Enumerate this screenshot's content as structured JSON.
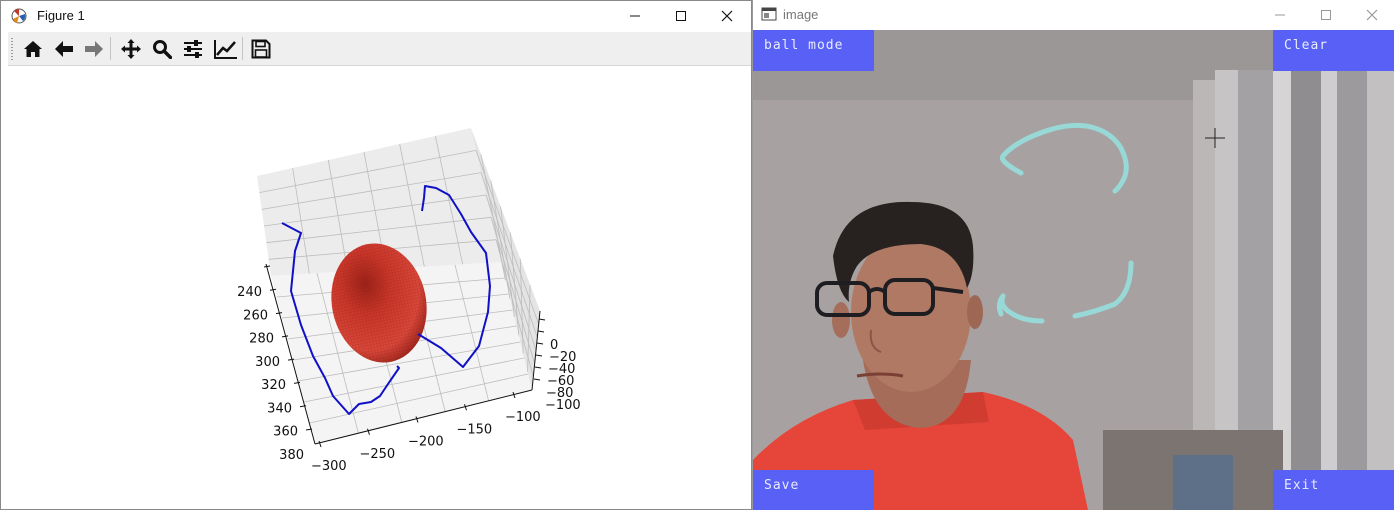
{
  "figure_window": {
    "title": "Figure 1",
    "toolbar": [
      "home-icon",
      "back-icon",
      "forward-icon",
      "pan-icon",
      "zoom-icon",
      "configure-subplots-icon",
      "edit-axes-icon",
      "save-icon"
    ]
  },
  "chart_data": {
    "type": "3d-scatter-line",
    "x_ticks": [
      "−300",
      "−250",
      "−200",
      "−150",
      "−100"
    ],
    "y_ticks": [
      "240",
      "260",
      "280",
      "300",
      "320",
      "340",
      "360",
      "380"
    ],
    "z_ticks": [
      "0",
      "−20",
      "−40",
      "−60",
      "−80",
      "−100"
    ],
    "series": [
      {
        "type": "line",
        "color": "#1010c8"
      },
      {
        "type": "ellipsoid-surface",
        "color": "#c0392b"
      }
    ],
    "grid": true,
    "colors": {
      "line": "#1010c8",
      "ellipsoid_light": "#d64a3a",
      "ellipsoid_dark": "#8a1a12",
      "pane": "#eaeaea",
      "grid": "#bcbcbc"
    }
  },
  "image_window": {
    "title": "image",
    "buttons": {
      "ball_mode": "ball mode",
      "clear": "Clear",
      "save": "Save",
      "exit": "Exit"
    },
    "colors": {
      "button_bg": "#5960f6",
      "stroke": "#98d8d6",
      "shirt": "#e8453a"
    }
  }
}
